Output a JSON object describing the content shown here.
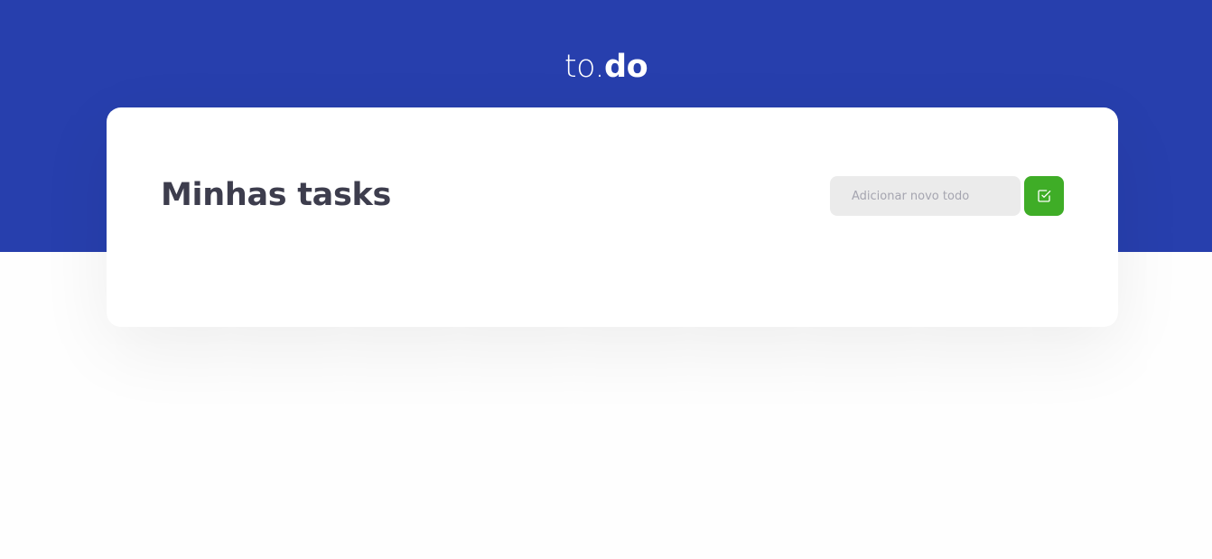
{
  "header": {
    "logo_prefix": "to.",
    "logo_suffix": "do",
    "background_color": "#273fad"
  },
  "main": {
    "title": "Minhas tasks"
  },
  "new_todo": {
    "input_value": "",
    "input_placeholder": "Adicionar novo todo",
    "button_icon": "check-square-icon",
    "button_color": "#3fad27"
  }
}
